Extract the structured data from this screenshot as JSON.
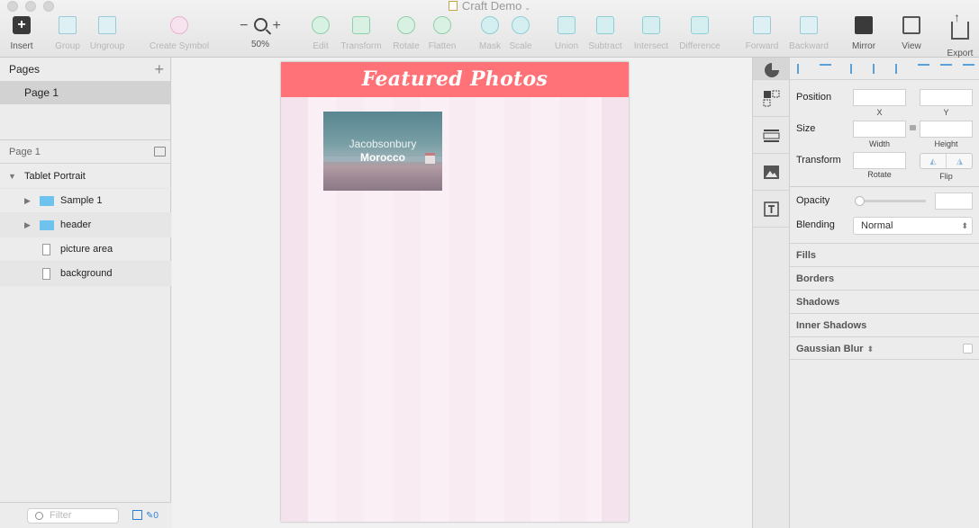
{
  "window": {
    "title": "Craft Demo"
  },
  "toolbar": {
    "insert": "Insert",
    "group": "Group",
    "ungroup": "Ungroup",
    "create_symbol": "Create Symbol",
    "zoom_minus": "−",
    "zoom_plus": "+",
    "zoom_level": "50%",
    "edit": "Edit",
    "transform": "Transform",
    "rotate": "Rotate",
    "flatten": "Flatten",
    "mask": "Mask",
    "scale": "Scale",
    "union": "Union",
    "subtract": "Subtract",
    "intersect": "Intersect",
    "difference": "Difference",
    "forward": "Forward",
    "backward": "Backward",
    "mirror": "Mirror",
    "view": "View",
    "export": "Export"
  },
  "pages": {
    "header": "Pages",
    "add": "+",
    "items": [
      {
        "label": "Page 1"
      }
    ]
  },
  "layers": {
    "page_label": "Page 1",
    "artboard": "Tablet Portrait",
    "items": [
      {
        "label": "Sample 1",
        "kind": "folder"
      },
      {
        "label": "header",
        "kind": "folder"
      },
      {
        "label": "picture area",
        "kind": "rectangle"
      },
      {
        "label": "background",
        "kind": "rectangle"
      }
    ]
  },
  "filter": {
    "placeholder": "Filter",
    "count": "0"
  },
  "artboard": {
    "title": "Featured Photos",
    "photo": {
      "city": "Jacobsonbury",
      "country": "Morocco"
    },
    "colors": {
      "header": "#ff7277",
      "background": "#fbeff6",
      "column": "#f4e2ec"
    }
  },
  "inspector": {
    "position": "Position",
    "x": "X",
    "y": "Y",
    "size": "Size",
    "width": "Width",
    "height": "Height",
    "transform": "Transform",
    "rotate": "Rotate",
    "flip": "Flip",
    "opacity": "Opacity",
    "blending": "Blending",
    "blending_value": "Normal",
    "sections": {
      "fills": "Fills",
      "borders": "Borders",
      "shadows": "Shadows",
      "inner_shadows": "Inner Shadows",
      "gaussian_blur": "Gaussian Blur"
    }
  }
}
